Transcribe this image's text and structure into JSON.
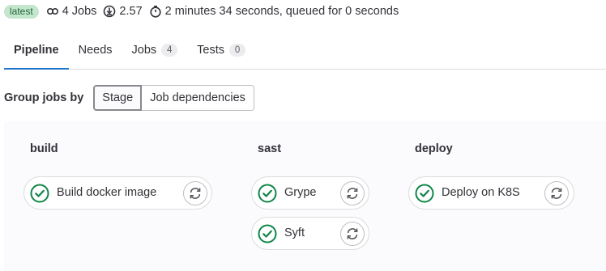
{
  "summary": {
    "latest_badge": "latest",
    "jobs_text": "4 Jobs",
    "version_text": "2.57",
    "duration_text": "2 minutes 34 seconds, queued for 0 seconds"
  },
  "tabs": [
    {
      "label": "Pipeline",
      "active": true
    },
    {
      "label": "Needs"
    },
    {
      "label": "Jobs",
      "count": "4"
    },
    {
      "label": "Tests",
      "count": "0"
    }
  ],
  "group_by": {
    "label": "Group jobs by",
    "options": [
      "Stage",
      "Job dependencies"
    ],
    "selected": "Stage"
  },
  "stages": [
    {
      "title": "build",
      "jobs": [
        {
          "name": "Build docker image",
          "status": "success"
        }
      ]
    },
    {
      "title": "sast",
      "jobs": [
        {
          "name": "Grype",
          "status": "success"
        },
        {
          "name": "Syft",
          "status": "success"
        }
      ]
    },
    {
      "title": "deploy",
      "jobs": [
        {
          "name": "Deploy on K8S",
          "status": "success"
        }
      ]
    }
  ],
  "colors": {
    "success": "#108548",
    "tab_underline": "#1f75cb",
    "latest_bg": "#c3e6cd",
    "latest_text": "#24663b"
  },
  "icons": {
    "jobs": "pipeline-link-icon",
    "version": "info-circle-icon",
    "duration": "stopwatch-icon",
    "job_status": "status-success-icon",
    "job_action": "retry-icon"
  }
}
